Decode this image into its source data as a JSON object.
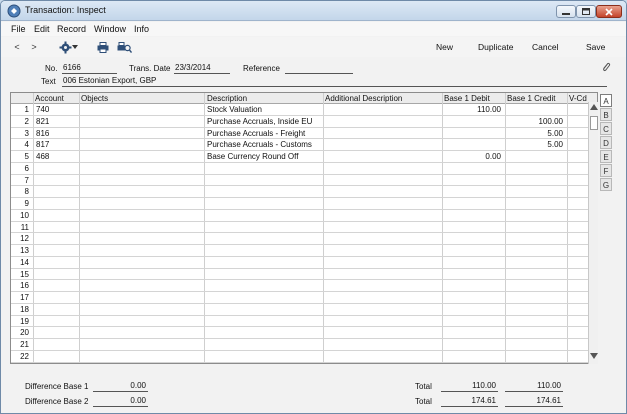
{
  "window": {
    "title": "Transaction: Inspect"
  },
  "menu": [
    {
      "label": "File"
    },
    {
      "label": "Edit"
    },
    {
      "label": "Record"
    },
    {
      "label": "Window"
    },
    {
      "label": "Info"
    }
  ],
  "toolbar": {
    "back": "<",
    "forward": ">",
    "buttons": {
      "new": "New",
      "duplicate": "Duplicate",
      "cancel": "Cancel",
      "save": "Save"
    },
    "icons": [
      "settings-gear-icon",
      "print-icon",
      "print-preview-icon",
      "paperclip-icon"
    ]
  },
  "header": {
    "no_label": "No.",
    "no_value": "6166",
    "date_label": "Trans. Date",
    "date_value": "23/3/2014",
    "ref_label": "Reference",
    "ref_value": "",
    "text_label": "Text",
    "text_value": "006 Estonian Export, GBP"
  },
  "grid": {
    "columns": [
      "",
      "Account",
      "Objects",
      "Description",
      "Additional Description",
      "Base 1 Debit",
      "Base 1 Credit",
      "V-Cd"
    ],
    "rows": [
      {
        "n": "1",
        "account": "740",
        "objects": "",
        "description": "Stock Valuation",
        "additional": "",
        "debit": "110.00",
        "credit": "",
        "vcd": ""
      },
      {
        "n": "2",
        "account": "821",
        "objects": "",
        "description": "Purchase Accruals, Inside EU",
        "additional": "",
        "debit": "",
        "credit": "100.00",
        "vcd": ""
      },
      {
        "n": "3",
        "account": "816",
        "objects": "",
        "description": "Purchase Accruals - Freight",
        "additional": "",
        "debit": "",
        "credit": "5.00",
        "vcd": ""
      },
      {
        "n": "4",
        "account": "817",
        "objects": "",
        "description": "Purchase Accruals - Customs",
        "additional": "",
        "debit": "",
        "credit": "5.00",
        "vcd": ""
      },
      {
        "n": "5",
        "account": "468",
        "objects": "",
        "description": "Base Currency Round Off",
        "additional": "",
        "debit": "0.00",
        "credit": "",
        "vcd": ""
      },
      {
        "n": "6"
      },
      {
        "n": "7"
      },
      {
        "n": "8"
      },
      {
        "n": "9"
      },
      {
        "n": "10"
      },
      {
        "n": "11"
      },
      {
        "n": "12"
      },
      {
        "n": "13"
      },
      {
        "n": "14"
      },
      {
        "n": "15"
      },
      {
        "n": "16"
      },
      {
        "n": "17"
      },
      {
        "n": "18"
      },
      {
        "n": "19"
      },
      {
        "n": "20"
      },
      {
        "n": "21"
      },
      {
        "n": "22"
      }
    ]
  },
  "tabs": [
    "A",
    "B",
    "C",
    "D",
    "E",
    "F",
    "G"
  ],
  "footer": {
    "diff1_label": "Difference Base 1",
    "diff1_value": "0.00",
    "diff2_label": "Difference Base 2",
    "diff2_value": "0.00",
    "total_label": "Total",
    "total1_debit": "110.00",
    "total1_credit": "110.00",
    "total2_debit": "174.61",
    "total2_credit": "174.61"
  }
}
